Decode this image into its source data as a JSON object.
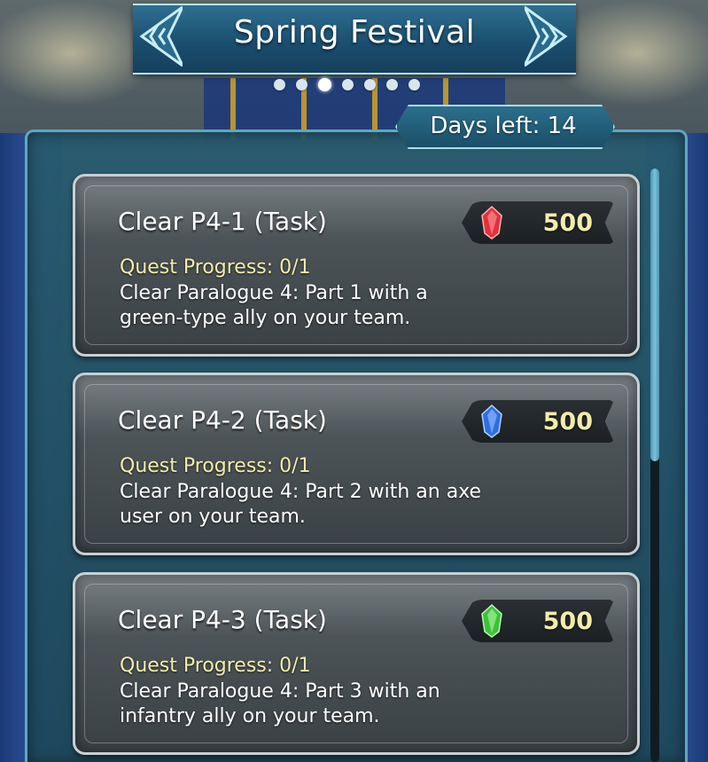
{
  "header": {
    "title": "Spring Festival",
    "page_count": 7,
    "active_page": 3
  },
  "days_left": "Days left: 14",
  "scroll_position": 0,
  "quests": [
    {
      "title": "Clear P4-1 (Task)",
      "progress": "Quest Progress: 0/1",
      "description": "Clear Paralogue 4: Part 1 with a green-type ally on your team.",
      "reward_icon": "red-orb-icon",
      "reward_color": "#e0323c",
      "reward_amount": "500"
    },
    {
      "title": "Clear P4-2 (Task)",
      "progress": "Quest Progress: 0/1",
      "description": "Clear Paralogue 4: Part 2 with an axe user on your team.",
      "reward_icon": "blue-orb-icon",
      "reward_color": "#2e6fe0",
      "reward_amount": "500"
    },
    {
      "title": "Clear P4-3 (Task)",
      "progress": "Quest Progress: 0/1",
      "description": "Clear Paralogue 4: Part 3 with an infantry ally on your team.",
      "reward_icon": "green-orb-icon",
      "reward_color": "#3ac23a",
      "reward_amount": "500"
    }
  ]
}
